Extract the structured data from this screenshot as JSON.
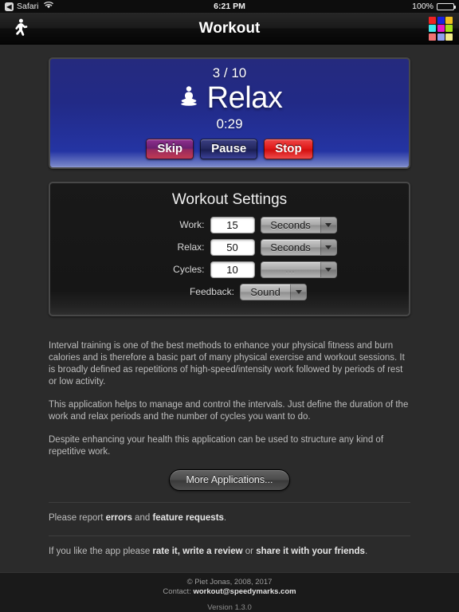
{
  "statusbar": {
    "back_badge": "◀",
    "app_name": "Safari",
    "wifi_icon": "wifi-icon",
    "time": "6:21 PM",
    "battery_percent": "100%"
  },
  "navbar": {
    "title": "Workout",
    "left_icon": "runner-icon",
    "right_icon": "color-grid-icon",
    "grid_colors": [
      "#ef2222",
      "#1a22e0",
      "#f0c020",
      "#40e8ee",
      "#ea17c6",
      "#a9e018",
      "#f07272",
      "#8f9ef0",
      "#f2eb8a"
    ]
  },
  "workout_panel": {
    "cycle_count": "3 / 10",
    "state_icon": "meditation-icon",
    "state_label": "Relax",
    "time_remaining": "0:29",
    "buttons": [
      {
        "label": "Skip",
        "name": "skip-button",
        "style": "btn-skip"
      },
      {
        "label": "Pause",
        "name": "pause-button",
        "style": "btn-pause"
      },
      {
        "label": "Stop",
        "name": "stop-button",
        "style": "btn-stop"
      }
    ],
    "panel_color": "#2434a3"
  },
  "settings": {
    "title": "Workout Settings",
    "rows": [
      {
        "label": "Work:",
        "value": "15",
        "unit": "Seconds",
        "unit_muted": false
      },
      {
        "label": "Relax:",
        "value": "50",
        "unit": "Seconds",
        "unit_muted": false
      },
      {
        "label": "Cycles:",
        "value": "10",
        "unit": "...",
        "unit_muted": true
      }
    ],
    "feedback": {
      "label": "Feedback:",
      "value": "Sound"
    }
  },
  "content": {
    "paragraph1": "Interval training is one of the best methods to enhance your physical fitness and burn calories and is therefore a basic part of many physical exercise and workout sessions. It is broadly defined as repetitions of high-speed/intensity work followed by periods of rest or low activity.",
    "paragraph2": "This application helps to manage and control the intervals. Just define the duration of the work and relax periods and the number of cycles you want to do.",
    "paragraph3": "Despite enhancing your health this application can be used to structure any kind of repetitive work.",
    "more_apps_label": "More Applications...",
    "report_prefix": "Please report ",
    "report_link1": "errors",
    "report_middle": " and ",
    "report_link2": "feature requests",
    "report_suffix": ".",
    "rate_prefix": "If you like the app please ",
    "rate_link1": "rate it, write a review",
    "rate_middle": " or ",
    "rate_link2": "share it with your friends",
    "rate_suffix": "."
  },
  "footer": {
    "copyright": "© Piet Jonas, 2008, 2017",
    "contact_prefix": "Contact: ",
    "contact_email": "workout@speedymarks.com",
    "version": "Version 1.3.0"
  }
}
